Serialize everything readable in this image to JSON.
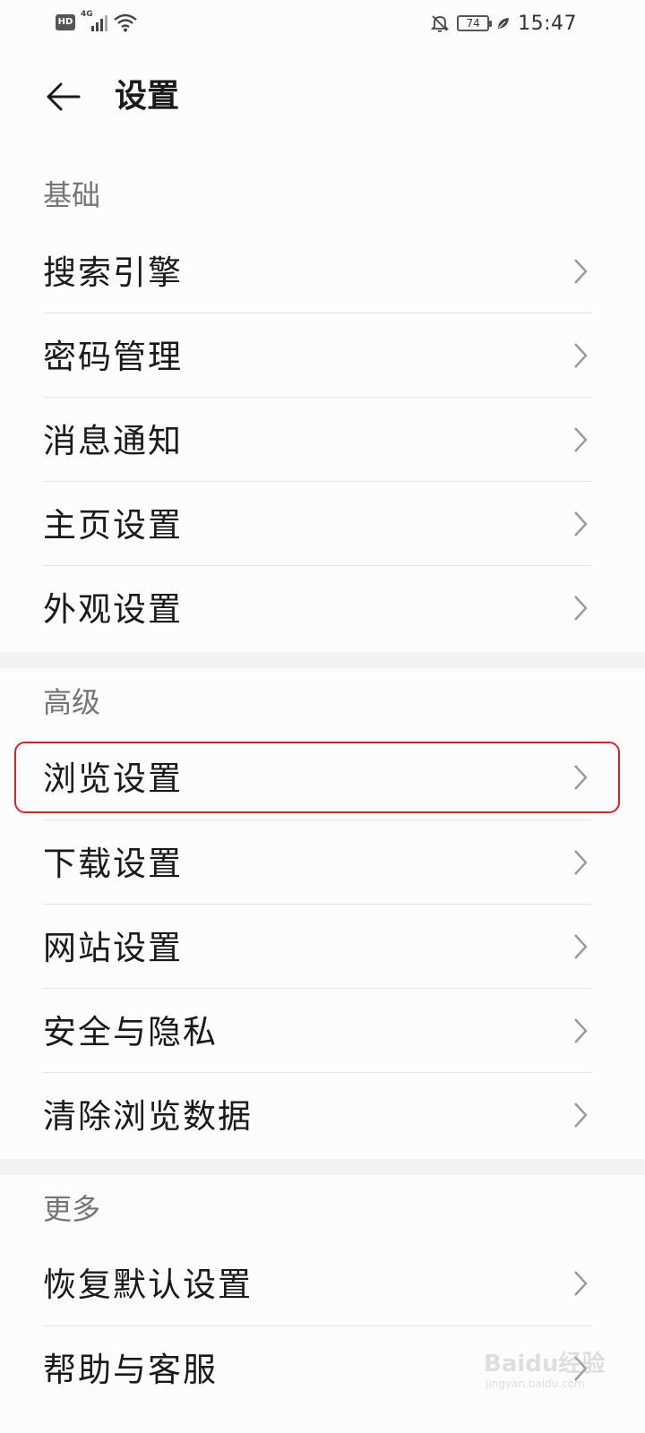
{
  "status_bar": {
    "hd_badge": "HD",
    "network": "4G",
    "battery_level": "74",
    "time": "15:47",
    "icons": [
      "hd-icon",
      "signal-icon",
      "wifi-icon",
      "mute-bell-icon",
      "battery-icon",
      "leaf-icon"
    ]
  },
  "header": {
    "back_icon": "back-arrow-icon",
    "title": "设置"
  },
  "sections": {
    "basic": {
      "title": "基础",
      "items": [
        "搜索引擎",
        "密码管理",
        "消息通知",
        "主页设置",
        "外观设置"
      ]
    },
    "advanced": {
      "title": "高级",
      "items": [
        "浏览设置",
        "下载设置",
        "网站设置",
        "安全与隐私",
        "清除浏览数据"
      ]
    },
    "more": {
      "title": "更多",
      "items": [
        "恢复默认设置",
        "帮助与客服"
      ]
    }
  },
  "highlighted_item": "浏览设置",
  "colors": {
    "highlight_border": "#d8232a",
    "section_title": "#757575",
    "background": "#fcfcfc"
  },
  "watermark": {
    "text": "Baidu经验",
    "sub": "jingyan.baidu.com"
  }
}
